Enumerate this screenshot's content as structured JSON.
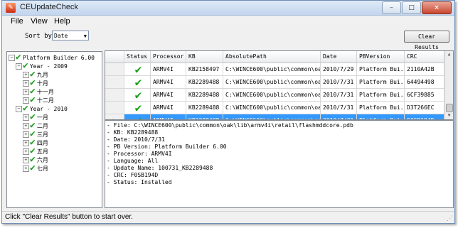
{
  "window": {
    "title": "CEUpdateCheck",
    "icon": "app-icon",
    "controls": {
      "minimize": "–",
      "maximize": "□",
      "close": "×"
    }
  },
  "menu": [
    "File",
    "View",
    "Help"
  ],
  "toolbar": {
    "sort_label": "Sort by:",
    "sort_value": "Date",
    "clear_button": "Clear Results"
  },
  "tree": {
    "root": "Platform Builder 6.00",
    "years": [
      {
        "label": "Year - 2009",
        "months": [
          "九月",
          "十月",
          "十一月",
          "十二月"
        ]
      },
      {
        "label": "Year - 2010",
        "months": [
          "一月",
          "二月",
          "三月",
          "四月",
          "五月",
          "六月",
          "七月"
        ]
      }
    ]
  },
  "grid": {
    "columns": [
      "Status",
      "Processor",
      "KB",
      "AbsolutePath",
      "Date",
      "PBVersion",
      "CRC"
    ],
    "rows": [
      {
        "processor": "ARMV4I",
        "kb": "KB2158497",
        "path": "C:\\WINCE600\\public\\common\\oak...",
        "date": "2010/7/29",
        "pbversion": "Platform Bui...",
        "crc": "2110A42B"
      },
      {
        "processor": "ARMV4I",
        "kb": "KB2289488",
        "path": "C:\\WINCE600\\public\\common\\oak...",
        "date": "2010/7/31",
        "pbversion": "Platform Bui...",
        "crc": "64494498"
      },
      {
        "processor": "ARMV4I",
        "kb": "KB2289488",
        "path": "C:\\WINCE600\\public\\common\\oak...",
        "date": "2010/7/31",
        "pbversion": "Platform Bui...",
        "crc": "6CF39885"
      },
      {
        "processor": "ARMV4I",
        "kb": "KB2289488",
        "path": "C:\\WINCE600\\public\\common\\oak...",
        "date": "2010/7/31",
        "pbversion": "Platform Bui...",
        "crc": "D3T266EC"
      },
      {
        "processor": "ARMV4I",
        "kb": "KB2289488",
        "path": "C:\\WINCE600\\public\\common\\oak...",
        "date": "2010/7/31",
        "pbversion": "Platform Bui...",
        "crc": "F0SB194D",
        "selected": true
      }
    ]
  },
  "details": [
    "- File: C:\\WINCE600\\public\\common\\oak\\lib\\armv4i\\retail\\flashmddcore.pdb",
    "- KB: KB2289488",
    "- Date: 2010/7/31",
    "- PB Version: Platform Builder 6.00",
    "- Processor: ARMV4I",
    "- Language: All",
    "- Update Name: 100731_KB2289488",
    "- CRC: F0SB194D",
    "- Status: Installed"
  ],
  "status_text": "Click \"Clear Results\" button to start over.",
  "colors": {
    "selection": "#3399ff",
    "check": "#1ea01e",
    "border": "#828790"
  }
}
